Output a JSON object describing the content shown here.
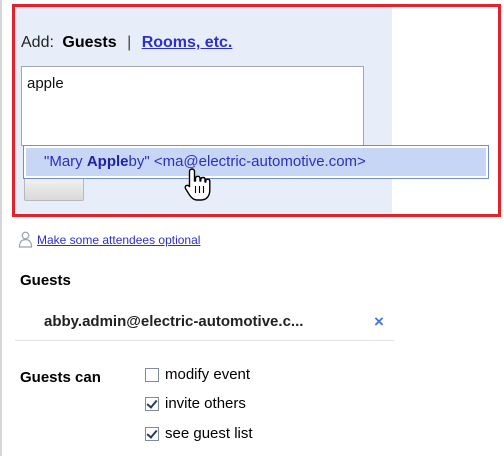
{
  "add_panel": {
    "add_label": "Add:",
    "guests_tab": "Guests",
    "separator": "|",
    "rooms_tab": "Rooms, etc.",
    "input_value": "apple",
    "suggestion": {
      "name_before": "\"Mary ",
      "name_match": "Apple",
      "name_after": "by\" <ma@electric-automotive.com>"
    }
  },
  "optional_link": "Make some attendees optional",
  "guests_section": {
    "title": "Guests",
    "guests": [
      {
        "email": "abby.admin@electric-automotive.c..."
      }
    ],
    "remove_symbol": "×"
  },
  "permissions": {
    "label": "Guests can",
    "options": [
      {
        "label": "modify event",
        "checked": false
      },
      {
        "label": "invite others",
        "checked": true
      },
      {
        "label": "see guest list",
        "checked": true
      }
    ]
  },
  "colors": {
    "panel_border": "#e3232b",
    "panel_background": "#e8eef9",
    "link": "#2d2fd0",
    "suggestion_highlight": "#c8d6f5",
    "remove_x": "#4577d6"
  }
}
